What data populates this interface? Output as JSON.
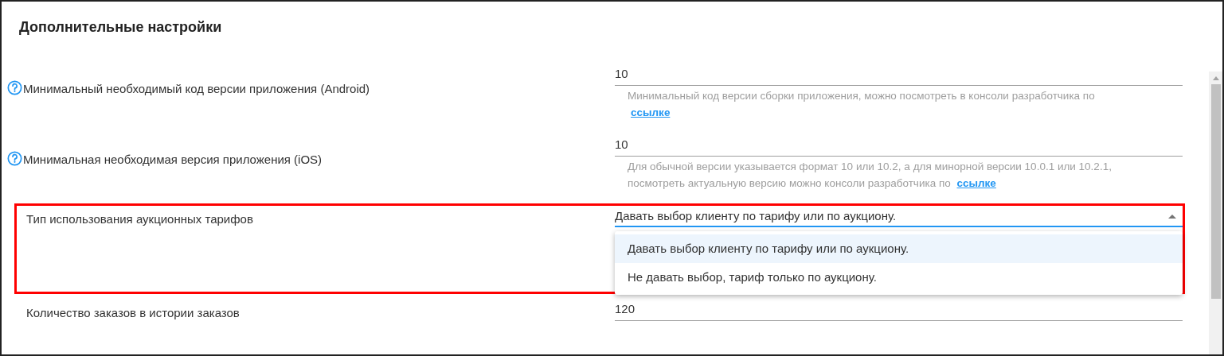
{
  "title": "Дополнительные настройки",
  "settings": [
    {
      "kind": "text",
      "label": "Минимальный необходимый код версии приложения (Android)",
      "help": true,
      "highlighted": false,
      "value": "10",
      "hint": {
        "text": "Минимальный код версии сборки приложения, можно посмотреть в консоли разработчика по",
        "link": "ссылке"
      }
    },
    {
      "kind": "text",
      "label": "Минимальная необходимая версия приложения (iOS)",
      "help": true,
      "highlighted": false,
      "value": "10",
      "hint": {
        "text": "Для обычной версии указывается формат 10 или 10.2, а для минорной версии 10.0.1 или 10.2.1, посмотреть актуальную версию можно консоли разработчика по",
        "link": "ссылке"
      }
    },
    {
      "kind": "select",
      "label": "Тип использования аукционных тарифов",
      "help": false,
      "highlighted": true,
      "expanded": true,
      "value": "Давать выбор клиенту по тарифу или по аукциону.",
      "options": [
        {
          "label": "Давать выбор клиенту по тарифу или по аукциону.",
          "selected": true
        },
        {
          "label": "Не давать выбор, тариф только по аукциону.",
          "selected": false
        }
      ]
    },
    {
      "kind": "text",
      "label": "Количество заказов в истории заказов",
      "help": false,
      "highlighted": false,
      "value": "120"
    }
  ]
}
